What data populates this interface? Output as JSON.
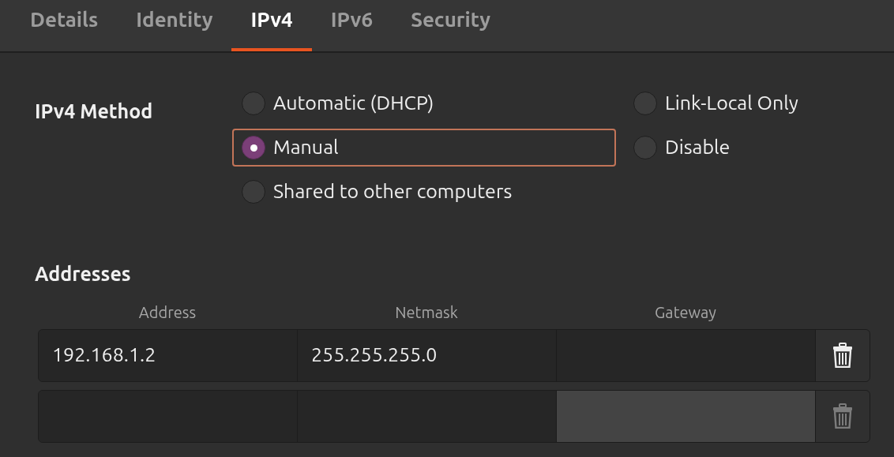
{
  "tabs": [
    {
      "label": "Details",
      "selected": false
    },
    {
      "label": "Identity",
      "selected": false
    },
    {
      "label": "IPv4",
      "selected": true
    },
    {
      "label": "IPv6",
      "selected": false
    },
    {
      "label": "Security",
      "selected": false
    }
  ],
  "method": {
    "label": "IPv4 Method",
    "options": [
      {
        "label": "Automatic (DHCP)",
        "selected": false,
        "focused": false
      },
      {
        "label": "Link-Local Only",
        "selected": false,
        "focused": false
      },
      {
        "label": "Manual",
        "selected": true,
        "focused": true
      },
      {
        "label": "Disable",
        "selected": false,
        "focused": false
      },
      {
        "label": "Shared to other computers",
        "selected": false,
        "focused": false
      }
    ]
  },
  "addresses": {
    "title": "Addresses",
    "columns": [
      "Address",
      "Netmask",
      "Gateway"
    ],
    "rows": [
      {
        "fields": [
          {
            "value": "192.168.1.2",
            "disabled": false
          },
          {
            "value": "255.255.255.0",
            "disabled": false
          },
          {
            "disabled": false
          }
        ],
        "delete_disabled": false
      },
      {
        "fields": [
          {
            "disabled": false
          },
          {
            "disabled": false
          },
          {
            "disabled": true
          }
        ],
        "delete_disabled": true
      }
    ]
  }
}
